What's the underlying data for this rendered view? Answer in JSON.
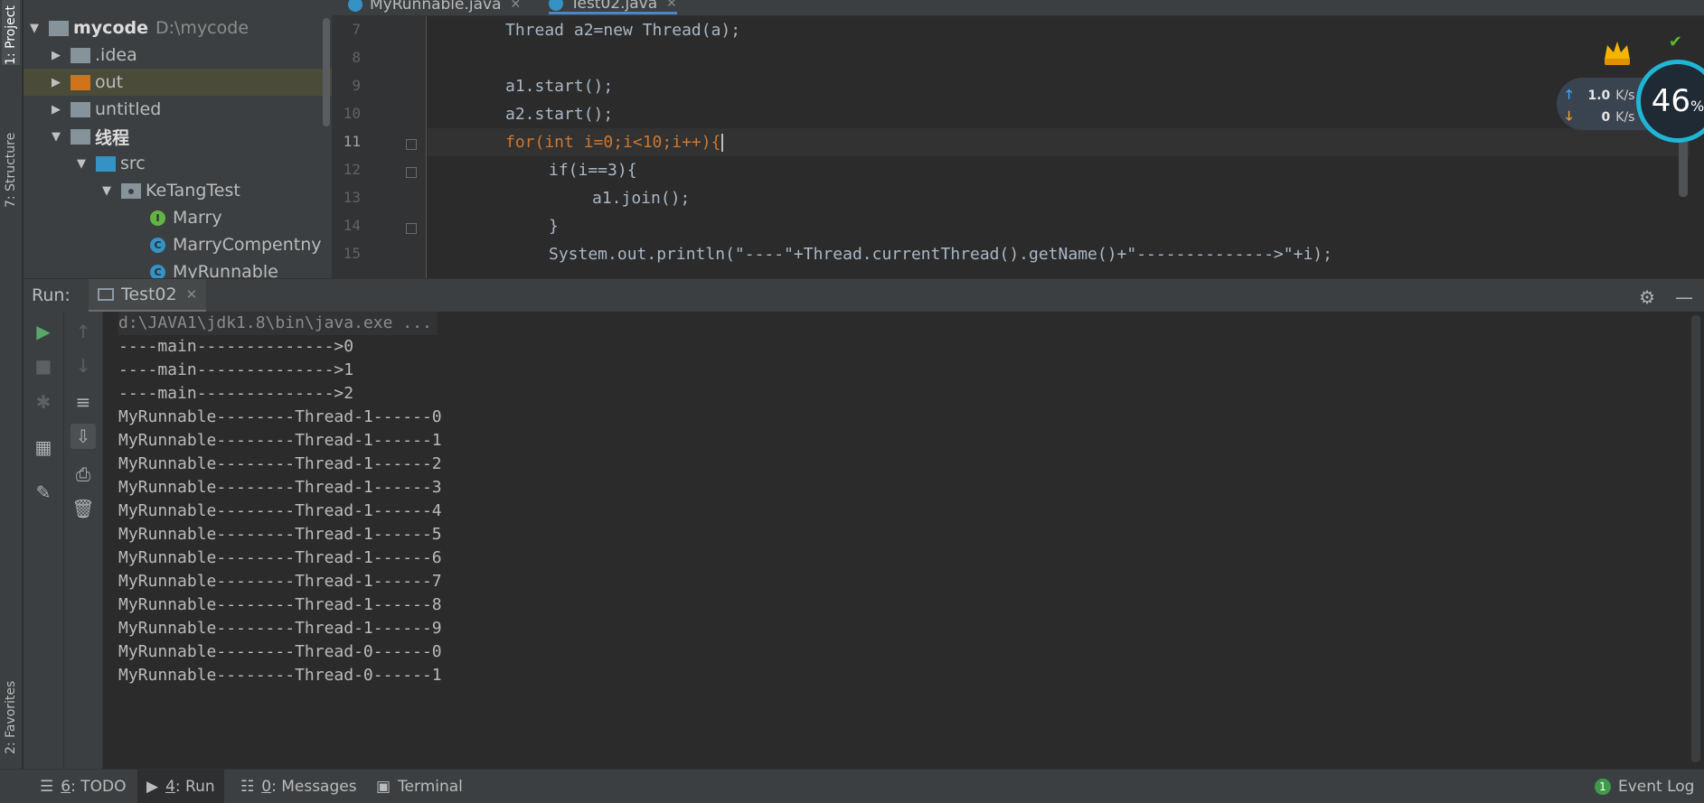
{
  "left_strip": {
    "project_tab": "1: Project",
    "structure_tab": "7: Structure",
    "favorites_tab": "2: Favorites"
  },
  "project": {
    "header_label": "Project",
    "items": [
      {
        "label": "mycode",
        "path": "D:\\mycode",
        "icon": "module-folder-icon"
      },
      {
        "label": ".idea",
        "icon": "folder-icon"
      },
      {
        "label": "out",
        "icon": "excluded-folder-icon"
      },
      {
        "label": "untitled",
        "icon": "folder-icon"
      },
      {
        "label": "线程",
        "icon": "module-folder-icon"
      },
      {
        "label": "src",
        "icon": "source-folder-icon"
      },
      {
        "label": "KeTangTest",
        "icon": "package-icon"
      },
      {
        "label": "Marry",
        "icon": "interface-icon",
        "glyph": "I"
      },
      {
        "label": "MarryCompentny",
        "icon": "class-icon",
        "glyph": "C"
      },
      {
        "label": "MyRunnable",
        "icon": "class-icon",
        "glyph": "C"
      }
    ]
  },
  "editor": {
    "tabs": [
      {
        "label": "MyRunnable.java"
      },
      {
        "label": "Test02.java",
        "active": true
      }
    ],
    "line_numbers": [
      "7",
      "8",
      "9",
      "10",
      "11",
      "12",
      "13",
      "14",
      "15"
    ],
    "code": {
      "l7": "Thread a2=new Thread(a);",
      "l9": "a1.start();",
      "l10": "a2.start();",
      "l11": "for(int i=0;i<10;i++){",
      "l12": "if(i==3){",
      "l13": "a1.join();",
      "l14": "}",
      "l15": "System.out.println(\"----\"+Thread.currentThread().getName()+\"-------------->\"+i);"
    }
  },
  "network_widget": {
    "upload": "1.0",
    "upload_unit": "K/s",
    "download": "0",
    "download_unit": "K/s",
    "percent": "46",
    "percent_sign": "%",
    "badge": "VIP"
  },
  "run": {
    "label": "Run:",
    "tab": "Test02",
    "output": [
      "d:\\JAVA1\\jdk1.8\\bin\\java.exe ...",
      "----main-------------->0",
      "----main-------------->1",
      "----main-------------->2",
      "MyRunnable--------Thread-1------0",
      "MyRunnable--------Thread-1------1",
      "MyRunnable--------Thread-1------2",
      "MyRunnable--------Thread-1------3",
      "MyRunnable--------Thread-1------4",
      "MyRunnable--------Thread-1------5",
      "MyRunnable--------Thread-1------6",
      "MyRunnable--------Thread-1------7",
      "MyRunnable--------Thread-1------8",
      "MyRunnable--------Thread-1------9",
      "MyRunnable--------Thread-0------0",
      "MyRunnable--------Thread-0------1"
    ]
  },
  "statusbar": {
    "todo_num": "6",
    "todo_label": ": TODO",
    "run_num": "4",
    "run_label": ": Run",
    "messages_num": "0",
    "messages_label": ": Messages",
    "terminal": "Terminal",
    "event_count": "1",
    "event_log": "Event Log"
  },
  "colors": {
    "accent": "#4a88c7",
    "run_green": "#59a869",
    "gauge": "#1fb6d6"
  }
}
